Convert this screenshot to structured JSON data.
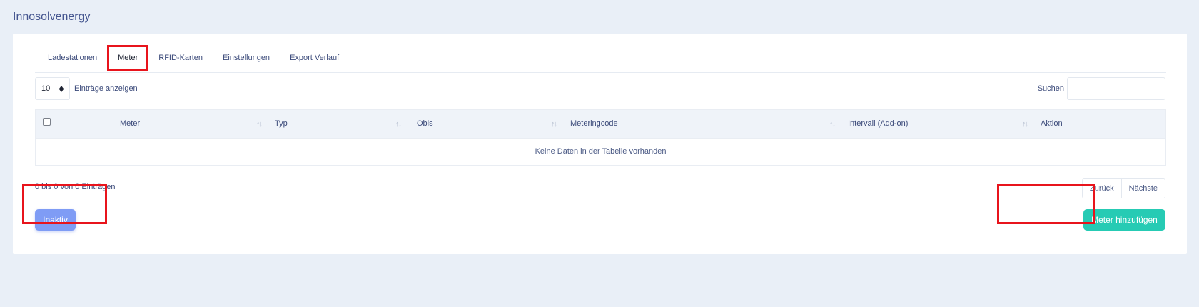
{
  "app": {
    "title": "Innosolvenergy"
  },
  "tabs": [
    {
      "label": "Ladestationen",
      "active": false
    },
    {
      "label": "Meter",
      "active": true
    },
    {
      "label": "RFID-Karten",
      "active": false
    },
    {
      "label": "Einstellungen",
      "active": false
    },
    {
      "label": "Export Verlauf",
      "active": false
    }
  ],
  "length_control": {
    "value": "10",
    "label": "Einträge anzeigen"
  },
  "search": {
    "label": "Suchen",
    "value": "",
    "placeholder": ""
  },
  "table": {
    "columns": [
      "Meter",
      "Typ",
      "Obis",
      "Meteringcode",
      "Intervall (Add-on)",
      "Aktion"
    ],
    "empty_message": "Keine Daten in der Tabelle vorhanden"
  },
  "info": {
    "text": "0 bis 0 von 0 Einträgen"
  },
  "pagination": {
    "prev": "Zurück",
    "next": "Nächste"
  },
  "actions": {
    "inactive_label": "Inaktiv",
    "add_label": "Meter hinzufügen"
  },
  "colors": {
    "background": "#e9eff7",
    "highlight": "#e8141c",
    "inactive_button": "#7f9cf5",
    "add_button": "#26cbb4"
  },
  "icons": {
    "sort": "sort-arrows-icon",
    "select": "spinner-icon"
  }
}
